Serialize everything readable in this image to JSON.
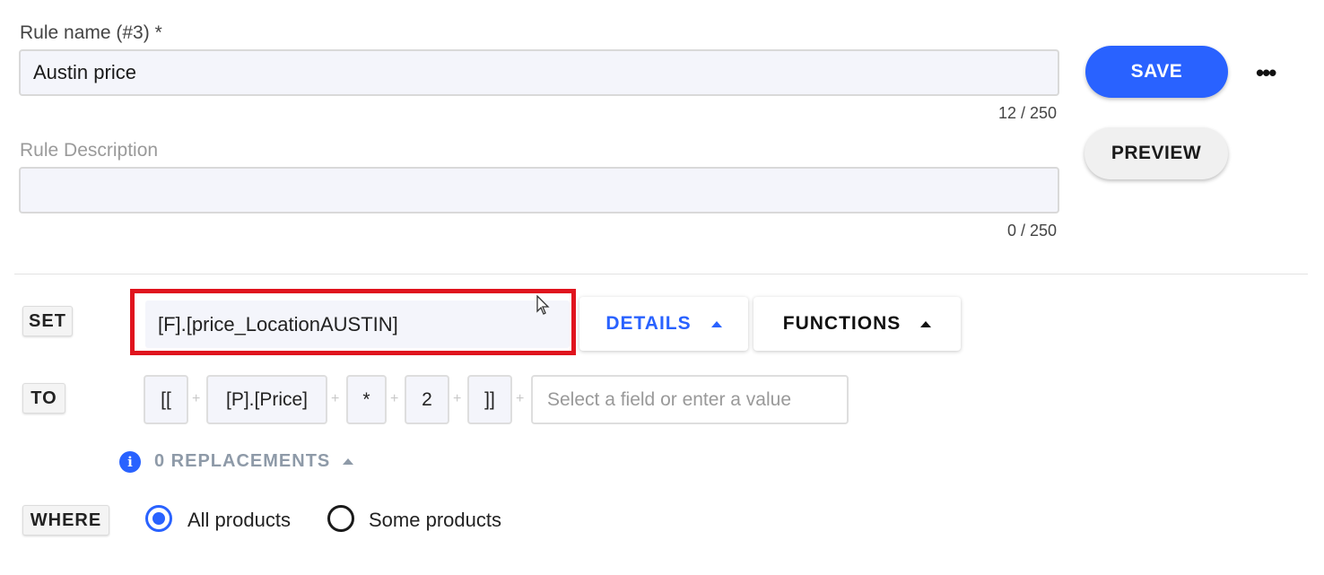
{
  "rule_name": {
    "label": "Rule name (#3) *",
    "value": "Austin price",
    "counter": "12 / 250"
  },
  "rule_description": {
    "label": "Rule Description",
    "value": "",
    "counter": "0 / 250"
  },
  "actions": {
    "save_label": "SAVE",
    "preview_label": "PREVIEW",
    "more_label": "•••"
  },
  "set_section": {
    "tag": "SET",
    "field_value": "[F].[price_LocationAUSTIN]",
    "details_label": "DETAILS",
    "functions_label": "FUNCTIONS"
  },
  "to_section": {
    "tag": "TO",
    "tokens": [
      "[[",
      "[P].[Price]",
      "*",
      "2",
      "]]"
    ],
    "plus_symbol": "+",
    "select_placeholder": "Select a field or enter a value"
  },
  "replacements": {
    "info_icon_glyph": "i",
    "label": "0 REPLACEMENTS"
  },
  "where_section": {
    "tag": "WHERE",
    "options": [
      {
        "label": "All products",
        "selected": true
      },
      {
        "label": "Some products",
        "selected": false
      }
    ]
  },
  "colors": {
    "accent": "#2962ff",
    "highlight_box": "#e0141e"
  }
}
